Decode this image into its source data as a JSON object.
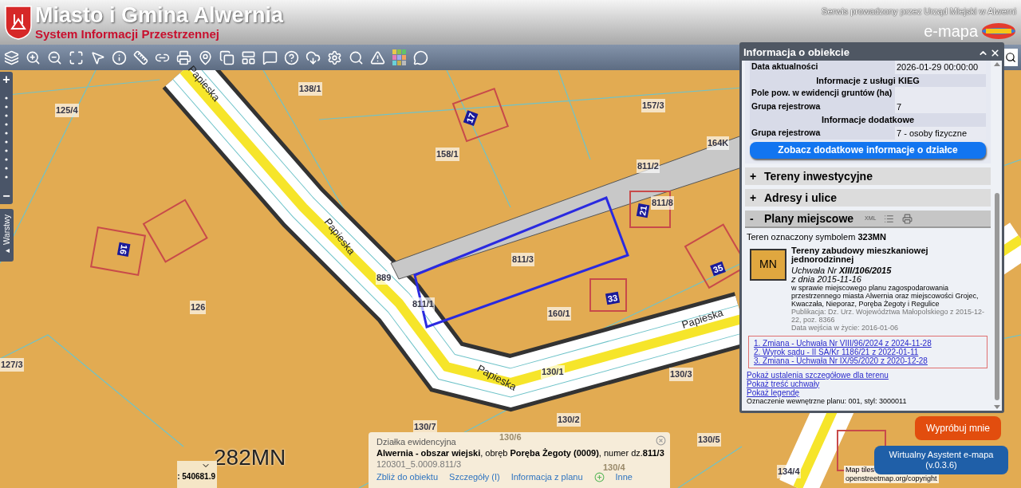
{
  "header": {
    "title": "Miasto i Gmina Alwernia",
    "subtitle": "System Informacji Przestrzennej",
    "service_note": "Serwis prowadzony przez Urząd Miejski w Alwerni",
    "brand": "e-mapa"
  },
  "map": {
    "zoom_plus": "+",
    "zoom_minus": "−",
    "layers_tab": "Warstwy",
    "layers_tab_arrow": "▸",
    "coordinate": ": 540681.9",
    "attribution_1": "Map tiles",
    "attribution_2": "openstreetmap.org/copyright",
    "labels": [
      "138/1",
      "125/4",
      "157/3",
      "158/1",
      "164K",
      "811/2",
      "811/8",
      "811/3",
      "889",
      "811/1",
      "160/1",
      "126",
      "127/3",
      "130/1",
      "130/3",
      "130/7",
      "130/2",
      "130/6",
      "130/5",
      "130/4",
      "134/4"
    ],
    "streets": [
      "Papieska",
      "Papieska",
      "Papieska",
      "Papieska"
    ],
    "house_numbers": [
      "17",
      "21",
      "16",
      "33",
      "35"
    ],
    "zone_label": "282MN"
  },
  "info_panel": {
    "title": "Informacja o obiekcie",
    "rows": [
      {
        "kind": "pair",
        "label": "Data aktualności",
        "value": "2026-01-29 00:00:00"
      },
      {
        "kind": "heading",
        "label": "Informacje z usługi KIEG"
      },
      {
        "kind": "pair",
        "label": "Pole pow. w ewidencji gruntów (ha)"
      },
      {
        "kind": "pair",
        "label": "Grupa rejestrowa",
        "value": "7"
      },
      {
        "kind": "heading",
        "label": "Informacje dodatkowe"
      },
      {
        "kind": "pair",
        "label": "Grupa rejestrowa",
        "value": "7 - osoby fizyczne"
      }
    ],
    "more_button": "Zobacz dodatkowe informacje o działce",
    "sections": [
      {
        "sign": "+",
        "title": "Tereny inwestycyjne",
        "expanded": false
      },
      {
        "sign": "+",
        "title": "Adresy i ulice",
        "expanded": false
      },
      {
        "sign": "-",
        "title": "Plany miejscowe",
        "expanded": true,
        "xml": "XML"
      }
    ],
    "plan": {
      "symbol_line": "Teren oznaczony symbolem **323MN**",
      "badge": "MN",
      "name": "Tereny zabudowy mieszkaniowej jednorodzinnej",
      "resolution": "Uchwała Nr **XIII/106/2015**",
      "date": "z dnia 2015-11-16",
      "subject": "w sprawie miejscowego planu zagospodarowania przestrzennego miasta Alwernia oraz miejscowości Grojec, Kwaczała, Nieporaz, Poręba Żegoty i Regulice",
      "publication": "Publikacja: Dz. Urz. Województwa Małopolskiego z 2015-12-22, poz. 8366",
      "effective": "Data wejścia w życie: 2016-01-06",
      "changes": [
        "1. Zmiana - Uchwała Nr VIII/96/2024 z 2024-11-28",
        "2. Wyrok sądu - II SA/Kr 1186/21 z 2022-01-11",
        "3. Zmiana - Uchwała Nr IX/95/2020 z 2020-12-28"
      ],
      "links": [
        "Pokaż ustalenia szczegółowe dla terenu",
        "Pokaż treść uchwały",
        "Pokaż legendę"
      ],
      "internal": "Oznaczenie wewnętrzne planu: 001, styl: 3000011"
    }
  },
  "parcel_popup": {
    "type": "Działka ewidencyjna",
    "description": "**Alwernia - obszar wiejski**, obręb **Poręba Żegoty (0009)**, numer dz.**811/3**",
    "id": "120301_5.0009.811/3",
    "actions": [
      "Zbliż do obiektu",
      "Szczegóły (I)",
      "Informacja z planu"
    ],
    "other": "Inne"
  },
  "assistant": {
    "try_button": "Wypróbuj mnie",
    "name": "Wirtualny Asystent e-mapa",
    "version": "(v.0.3.6)"
  }
}
